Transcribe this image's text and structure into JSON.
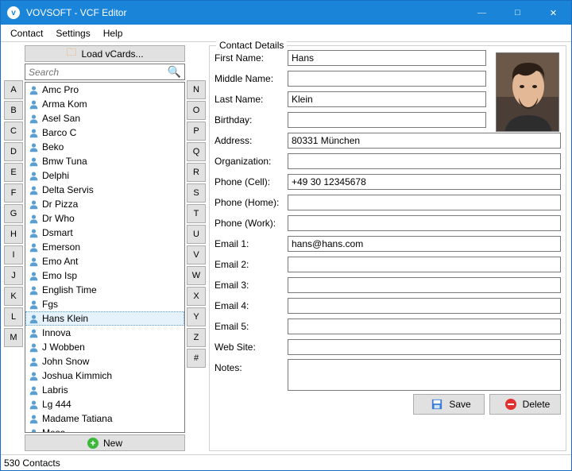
{
  "window": {
    "title": "VOVSOFT - VCF Editor"
  },
  "menu": {
    "contact": "Contact",
    "settings": "Settings",
    "help": "Help"
  },
  "buttons": {
    "load": "Load vCards...",
    "new": "New",
    "save": "Save",
    "delete": "Delete"
  },
  "search": {
    "placeholder": "Search"
  },
  "alpha_left": [
    "A",
    "B",
    "C",
    "D",
    "E",
    "F",
    "G",
    "H",
    "I",
    "J",
    "K",
    "L",
    "M"
  ],
  "alpha_right": [
    "N",
    "O",
    "P",
    "Q",
    "R",
    "S",
    "T",
    "U",
    "V",
    "W",
    "X",
    "Y",
    "Z",
    "#"
  ],
  "contacts": [
    {
      "name": "Amc Pro",
      "selected": false
    },
    {
      "name": "Arma Kom",
      "selected": false
    },
    {
      "name": "Asel San",
      "selected": false
    },
    {
      "name": "Barco C",
      "selected": false
    },
    {
      "name": "Beko",
      "selected": false
    },
    {
      "name": "Bmw Tuna",
      "selected": false
    },
    {
      "name": "Delphi",
      "selected": false
    },
    {
      "name": "Delta Servis",
      "selected": false
    },
    {
      "name": "Dr Pizza",
      "selected": false
    },
    {
      "name": "Dr Who",
      "selected": false
    },
    {
      "name": "Dsmart",
      "selected": false
    },
    {
      "name": "Emerson",
      "selected": false
    },
    {
      "name": "Emo Ant",
      "selected": false
    },
    {
      "name": "Emo Isp",
      "selected": false
    },
    {
      "name": "English Time",
      "selected": false
    },
    {
      "name": "Fgs",
      "selected": false
    },
    {
      "name": "Hans Klein",
      "selected": true
    },
    {
      "name": "Innova",
      "selected": false
    },
    {
      "name": "J Wobben",
      "selected": false
    },
    {
      "name": "John Snow",
      "selected": false
    },
    {
      "name": "Joshua Kimmich",
      "selected": false
    },
    {
      "name": "Labris",
      "selected": false
    },
    {
      "name": "Lg 444",
      "selected": false
    },
    {
      "name": "Madame Tatiana",
      "selected": false
    },
    {
      "name": "Mesa",
      "selected": false
    }
  ],
  "details": {
    "legend": "Contact Details",
    "fields": {
      "first_name": {
        "label": "First Name:",
        "value": "Hans"
      },
      "middle_name": {
        "label": "Middle Name:",
        "value": ""
      },
      "last_name": {
        "label": "Last Name:",
        "value": "Klein"
      },
      "birthday": {
        "label": "Birthday:",
        "value": ""
      },
      "address": {
        "label": "Address:",
        "value": "80331 München"
      },
      "organization": {
        "label": "Organization:",
        "value": ""
      },
      "phone_cell": {
        "label": "Phone (Cell):",
        "value": "+49 30 12345678"
      },
      "phone_home": {
        "label": "Phone (Home):",
        "value": ""
      },
      "phone_work": {
        "label": "Phone (Work):",
        "value": ""
      },
      "email1": {
        "label": "Email 1:",
        "value": "hans@hans.com"
      },
      "email2": {
        "label": "Email 2:",
        "value": ""
      },
      "email3": {
        "label": "Email 3:",
        "value": ""
      },
      "email4": {
        "label": "Email 4:",
        "value": ""
      },
      "email5": {
        "label": "Email 5:",
        "value": ""
      },
      "website": {
        "label": "Web Site:",
        "value": ""
      },
      "notes": {
        "label": "Notes:",
        "value": ""
      }
    }
  },
  "status": "530 Contacts"
}
